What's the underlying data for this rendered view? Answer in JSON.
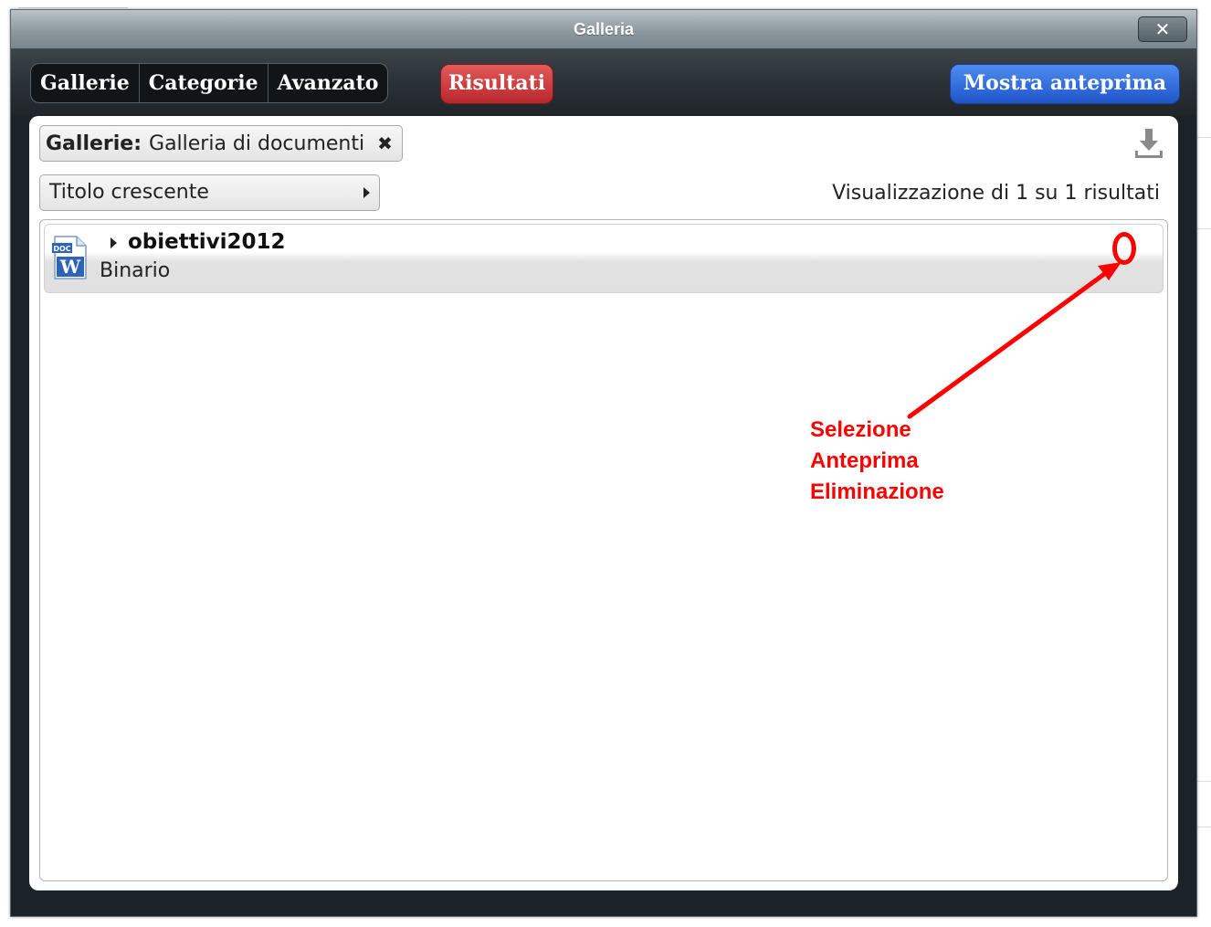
{
  "window": {
    "title": "Galleria",
    "close_symbol": "✕"
  },
  "toolbar": {
    "tabs": [
      {
        "label": "Gallerie"
      },
      {
        "label": "Categorie"
      },
      {
        "label": "Avanzato"
      }
    ],
    "results_button": "Risultati",
    "preview_button": "Mostra anteprima"
  },
  "filter": {
    "label": "Gallerie:",
    "value": "Galleria di documenti",
    "remove_symbol": "✖"
  },
  "sort": {
    "selected": "Titolo crescente"
  },
  "results_summary": "Visualizzazione di 1 su 1 risultati",
  "results": [
    {
      "name": "obiettivi2012",
      "type": "Binario",
      "icon": "word-document-icon"
    }
  ],
  "annotation": {
    "lines": [
      "Selezione",
      "Anteprima",
      "Eliminazione"
    ],
    "color": "#ff0000"
  },
  "colors": {
    "results_button": "#c93a3d",
    "preview_button": "#2a65dc",
    "annotation": "#ff0000"
  }
}
